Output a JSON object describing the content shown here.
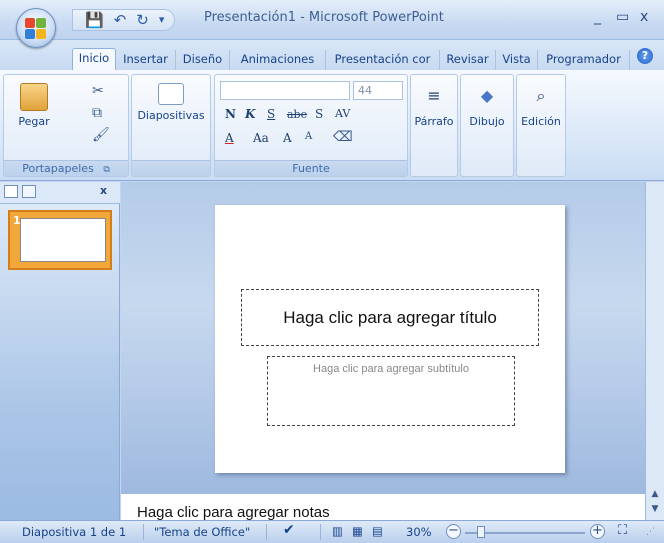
{
  "window": {
    "title": "Presentación1 - Microsoft PowerPoint",
    "minimize": "_",
    "maximize": "▭",
    "close": "x"
  },
  "qat": {
    "save": "💾",
    "undo": "↶",
    "redo": "↻",
    "customize": "▾"
  },
  "tabs": [
    {
      "label": "Inicio",
      "active": true
    },
    {
      "label": "Insertar"
    },
    {
      "label": "Diseño"
    },
    {
      "label": "Animaciones"
    },
    {
      "label": "Presentación cor"
    },
    {
      "label": "Revisar"
    },
    {
      "label": "Vista"
    },
    {
      "label": "Programador"
    }
  ],
  "ribbon": {
    "clipboard": {
      "group_label": "Portapapeles",
      "paste_label": "Pegar"
    },
    "slides": {
      "group_label": "",
      "button_label": "Diapositivas"
    },
    "font": {
      "group_label": "Fuente",
      "font_name": "",
      "font_size": "44",
      "bold": "N",
      "italic": "K",
      "underline": "S",
      "strike": "abe",
      "shadow": "S",
      "spacing": "AV",
      "color": "A",
      "case": "Aa",
      "grow": "A",
      "shrink": "A"
    },
    "paragraph": {
      "label": "Párrafo"
    },
    "drawing": {
      "label": "Dibujo"
    },
    "editing": {
      "label": "Edición"
    }
  },
  "slide": {
    "number": "1",
    "title_placeholder": "Haga clic para agregar título",
    "subtitle_placeholder": "Haga clic para agregar subtítulo"
  },
  "notes": {
    "placeholder": "Haga clic para agregar notas"
  },
  "status": {
    "slide_counter": "Diapositiva 1 de 1",
    "theme": "\"Tema de Office\"",
    "zoom": "30%",
    "zoom_level": 0.3
  }
}
